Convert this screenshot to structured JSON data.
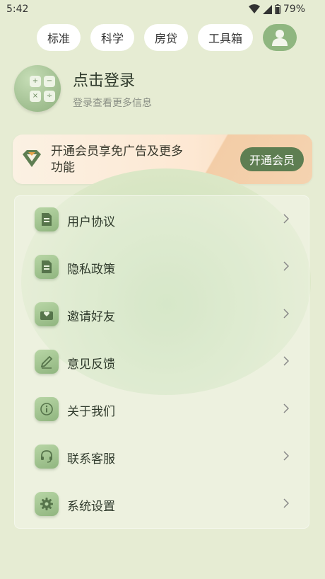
{
  "status": {
    "time": "5:42",
    "battery": "79%"
  },
  "tabs": [
    {
      "label": "标准"
    },
    {
      "label": "科学"
    },
    {
      "label": "房贷"
    },
    {
      "label": "工具箱"
    }
  ],
  "user": {
    "name": "点击登录",
    "subtitle": "登录查看更多信息"
  },
  "vip": {
    "text": "开通会员享免广告及更多功能",
    "button": "开通会员"
  },
  "menu": [
    {
      "label": "用户协议",
      "icon": "document-icon"
    },
    {
      "label": "隐私政策",
      "icon": "document-icon"
    },
    {
      "label": "邀请好友",
      "icon": "heart-mail-icon"
    },
    {
      "label": "意见反馈",
      "icon": "pencil-icon"
    },
    {
      "label": "关于我们",
      "icon": "info-icon"
    },
    {
      "label": "联系客服",
      "icon": "headset-icon"
    },
    {
      "label": "系统设置",
      "icon": "gear-icon"
    }
  ],
  "colors": {
    "background": "#e6ecd3",
    "accent": "#5e7e52",
    "icon_green": "#90b57f",
    "vip_bg": "#fde8d3"
  }
}
